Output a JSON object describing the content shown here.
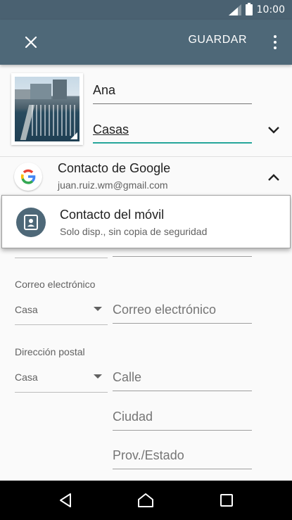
{
  "status_bar": {
    "time": "10:00",
    "signal_icon": "signal-icon",
    "battery_icon": "battery-icon"
  },
  "app_bar": {
    "close_icon": "close-icon",
    "save_label": "GUARDAR",
    "menu_icon": "more-vert-icon"
  },
  "contact": {
    "first_name": "Ana",
    "name_type": "Casas"
  },
  "account": {
    "title": "Contacto de Google",
    "email": "juan.ruiz.wm@gmail.com"
  },
  "account_popup": {
    "title": "Contacto del móvil",
    "subtitle": "Solo disp., sin copia de seguridad"
  },
  "email_section": {
    "label": "Correo electrónico",
    "type": "Casa",
    "placeholder": "Correo electrónico"
  },
  "address_section": {
    "label": "Dirección postal",
    "type": "Casa",
    "street_placeholder": "Calle",
    "city_placeholder": "Ciudad",
    "state_placeholder": "Prov./Estado"
  },
  "colors": {
    "app_bar": "#4e6878",
    "status_bar": "#4a6171",
    "accent": "#26a69a"
  }
}
